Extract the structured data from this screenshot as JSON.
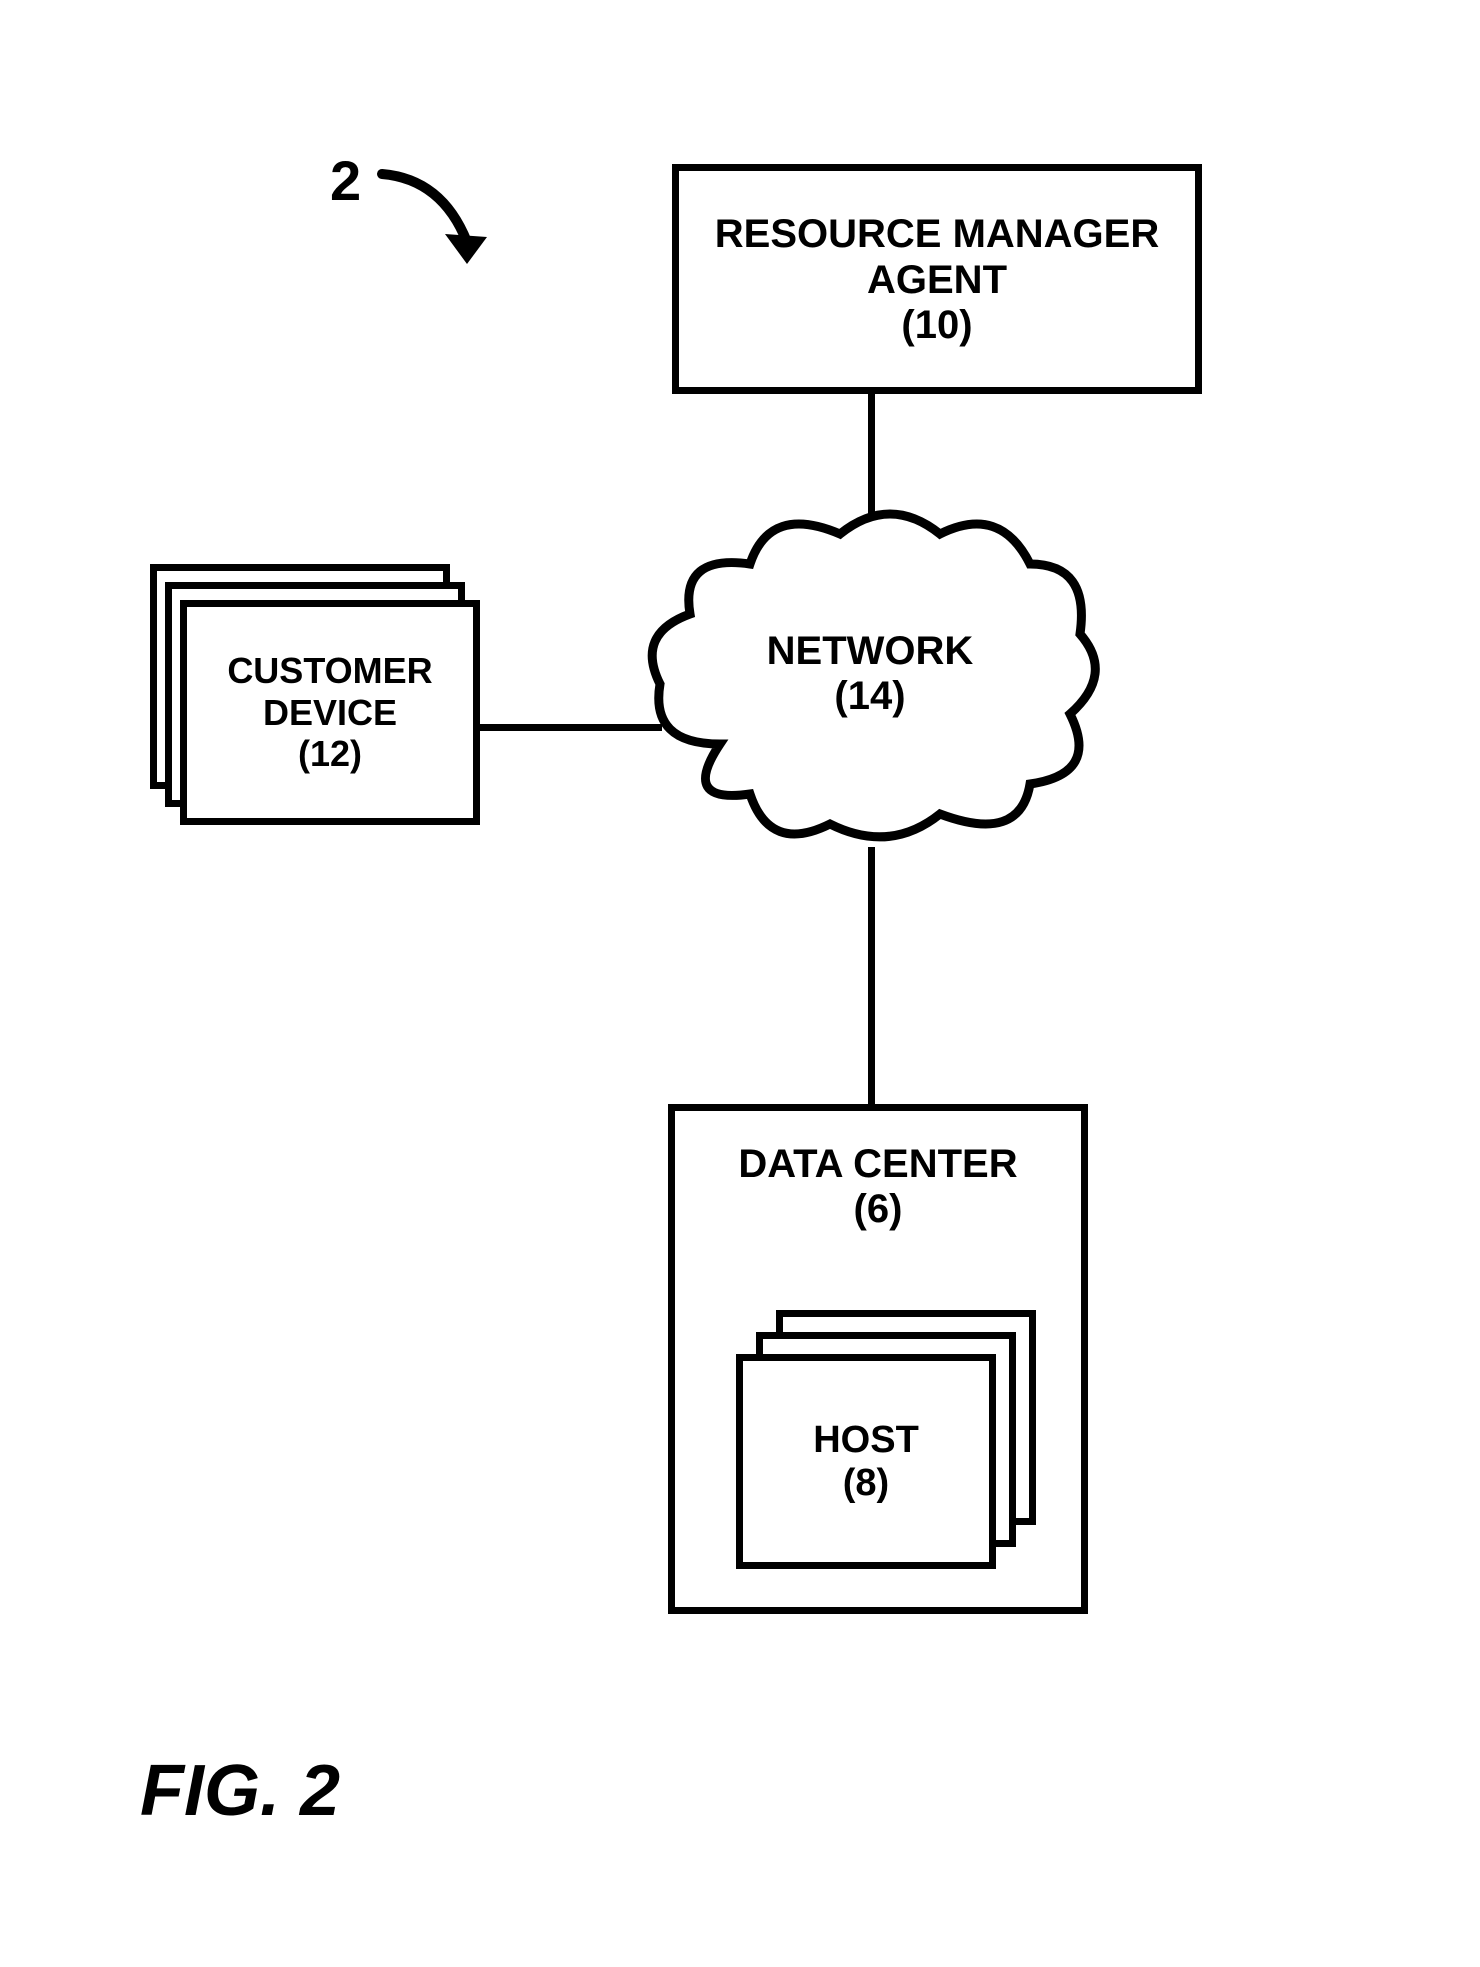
{
  "figure": {
    "label": "FIG. 2",
    "reference_number": "2"
  },
  "nodes": {
    "resource_manager": {
      "title_line1": "RESOURCE MANAGER",
      "title_line2": "AGENT",
      "number": "(10)"
    },
    "customer_device": {
      "title_line1": "CUSTOMER",
      "title_line2": "DEVICE",
      "number": "(12)"
    },
    "network": {
      "title": "NETWORK",
      "number": "(14)"
    },
    "data_center": {
      "title": "DATA CENTER",
      "number": "(6)"
    },
    "host": {
      "title": "HOST",
      "number": "(8)"
    }
  }
}
